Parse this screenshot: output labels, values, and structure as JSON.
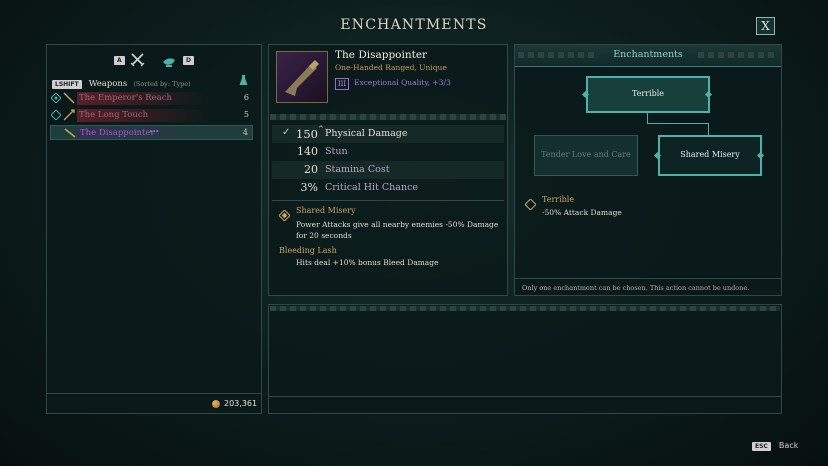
{
  "header": {
    "title": "ENCHANTMENTS",
    "close_label": "X"
  },
  "left": {
    "keys": {
      "left_key": "A",
      "right_key": "D",
      "shift_key": "LSHIFT"
    },
    "category": "Weapons",
    "sorted_by": "(Sorted by: Type)",
    "items": [
      {
        "name": "The Emperor's Reach",
        "count": "6"
      },
      {
        "name": "The Long Touch",
        "count": "5"
      },
      {
        "name": "The Disappointer",
        "count": "4"
      }
    ],
    "currency": "203,361"
  },
  "item": {
    "name": "The Disappointer",
    "type": "One-Handed Ranged, Unique",
    "quality": "Exceptional Quality, +3/3",
    "quality_tier": "III",
    "stats": [
      {
        "value": "150",
        "label": "Physical Damage"
      },
      {
        "value": "140",
        "label": "Stun"
      },
      {
        "value": "20",
        "label": "Stamina Cost"
      },
      {
        "value": "3%",
        "label": "Critical Hit Chance"
      }
    ],
    "enchant1_name": "Shared Misery",
    "enchant1_desc": "Power Attacks give all nearby enemies -50% Damage for 20 seconds",
    "enchant2_name": "Bleeding Lash",
    "enchant2_desc": "Hits deal +10% bonus Bleed Damage"
  },
  "enchant": {
    "title": "Enchantments",
    "top_node": "Terrible",
    "left_node": "Tender Love and Care",
    "right_node": "Shared Misery",
    "selected_name": "Terrible",
    "selected_desc": "-50% Attack Damage",
    "note": "Only one enchantment can be chosen. This action cannot be undone."
  },
  "footer": {
    "back_key": "ESC",
    "back_label": "Back"
  },
  "colors": {
    "accent": "#4fb1a8",
    "gold": "#c9a063",
    "purple": "#9a6ad0",
    "red_row": "#5a1f2a"
  }
}
